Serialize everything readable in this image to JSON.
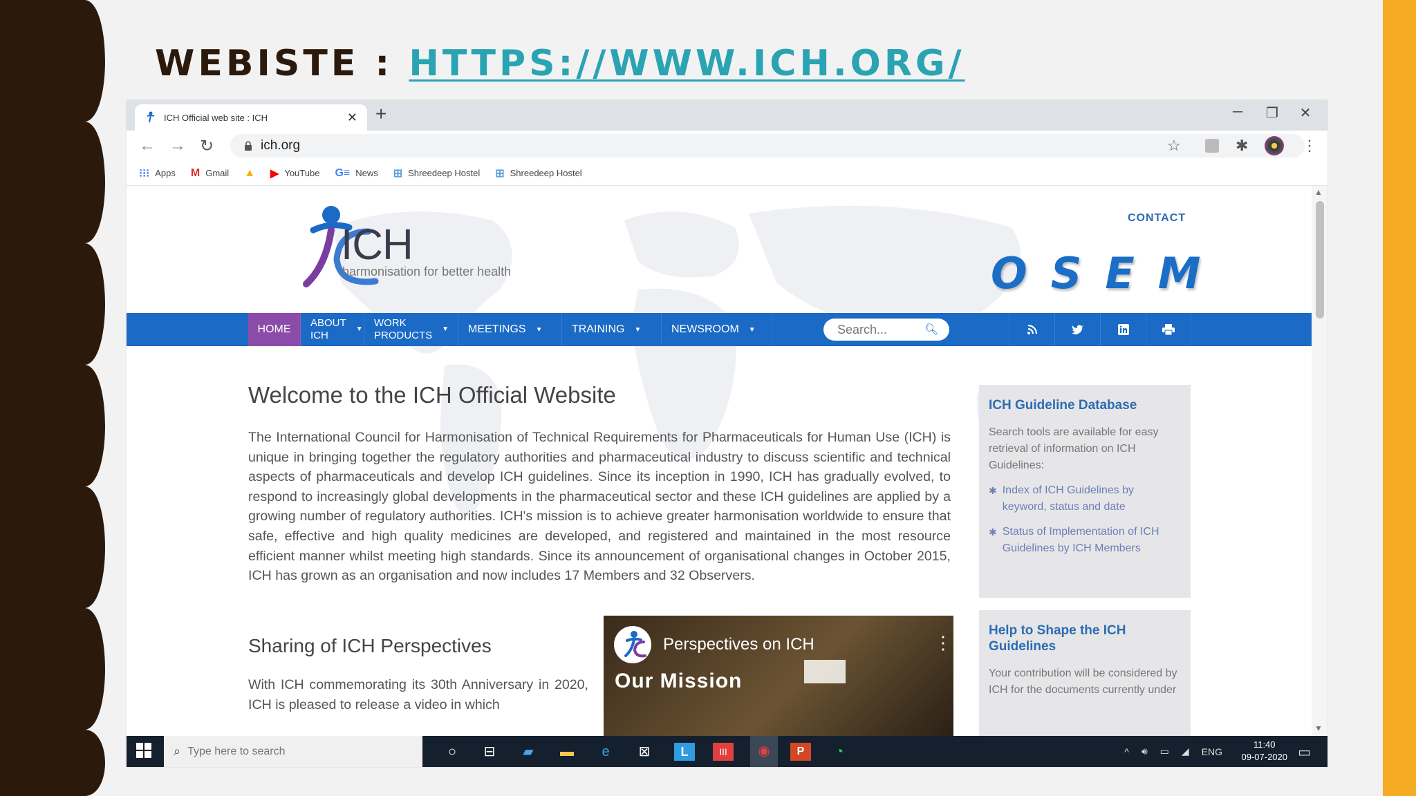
{
  "slide": {
    "title_prefix": "WEBISTE : ",
    "title_link": "HTTPS://WWW.ICH.ORG/",
    "colors": {
      "left_band": "#2b1a0c",
      "right_band": "#f5ac24",
      "link": "#2aa3b3"
    }
  },
  "browser": {
    "tab_title": "ICH Official web site : ICH",
    "tab_close": "✕",
    "new_tab": "+",
    "window_controls": {
      "minimize": "─",
      "restore": "❐",
      "close": "✕"
    },
    "nav": {
      "back": "←",
      "forward": "→",
      "reload": "↻"
    },
    "url": "ich.org",
    "lock_icon": "lock-icon",
    "toolbar_icons": {
      "star": "☆",
      "extensions": "✱",
      "menu": "⋮"
    },
    "bookmarks": [
      {
        "icon": "⁝⁝⁝",
        "label": "Apps",
        "color": "#4285f4"
      },
      {
        "icon": "M",
        "label": "Gmail",
        "color": "#d93025"
      },
      {
        "icon": "▲",
        "label": "",
        "color": "#f4b400"
      },
      {
        "icon": "▶",
        "label": "YouTube",
        "color": "#ff0000"
      },
      {
        "icon": "G≡",
        "label": "News",
        "color": "#4285f4"
      },
      {
        "icon": "⊞",
        "label": "Shreedeep Hostel",
        "color": "#5ba0e0"
      },
      {
        "icon": "⊞",
        "label": "Shreedeep Hostel",
        "color": "#5ba0e0"
      }
    ]
  },
  "site": {
    "logo_text": "ICH",
    "logo_tagline": "harmonisation for better health",
    "contact": "CONTACT",
    "osem": [
      "O",
      "S",
      "E",
      "M"
    ],
    "nav": {
      "home": "HOME",
      "about_1": "ABOUT",
      "about_2": "ICH",
      "work_1": "WORK",
      "work_2": "PRODUCTS",
      "meetings": "MEETINGS",
      "training": "TRAINING",
      "newsroom": "NEWSROOM",
      "search_placeholder": "Search..."
    },
    "social": {
      "rss": "rss-icon",
      "twitter": "twitter-icon",
      "linkedin": "linkedin-icon",
      "print": "print-icon"
    },
    "welcome_title": "Welcome to the ICH Official Website",
    "welcome_body": "The International Council for Harmonisation of Technical Requirements for Pharmaceuticals for Human Use (ICH) is unique in bringing together the regulatory authorities and pharmaceutical industry to discuss scientific and technical aspects of pharmaceuticals and develop ICH guidelines. Since its inception in 1990, ICH has gradually evolved, to respond to increasingly global developments in the pharmaceutical sector and these ICH guidelines are applied by a growing number of regulatory authorities. ICH's mission is to achieve greater harmonisation worldwide to ensure that safe, effective and high quality medicines are developed, and registered and maintained in the most resource efficient manner whilst meeting high standards. Since its announcement of organisational changes in October 2015, ICH has grown as an organisation and now includes 17 Members and 32 Observers.",
    "sharing_title": "Sharing of ICH Perspectives",
    "sharing_body": "With ICH commemorating its 30th Anniversary in 2020, ICH is pleased to release a video in which",
    "video": {
      "title": "Perspectives on ICH",
      "subtitle": "Our Mission",
      "menu": "⋮"
    },
    "sidebar1": {
      "title": "ICH Guideline Database",
      "text": "Search tools are available for easy retrieval of information on ICH Guidelines:",
      "link1": "Index of ICH Guidelines by keyword, status and date",
      "link2": "Status of Implementation of ICH Guidelines by ICH Members"
    },
    "sidebar2": {
      "title": "Help to Shape the ICH Guidelines",
      "text": "Your contribution will be considered by ICH for the documents currently under"
    },
    "colors": {
      "navbar": "#1a6ac6",
      "home_active": "#8b4ba8",
      "osem": "#1b6ec6",
      "sidebar_title": "#2d6cb3"
    }
  },
  "taskbar": {
    "search_placeholder": "Type here to search",
    "lang": "ENG",
    "time": "11:40",
    "date": "09-07-2020",
    "tray": {
      "up": "^",
      "volume": "🔊︎"
    }
  }
}
